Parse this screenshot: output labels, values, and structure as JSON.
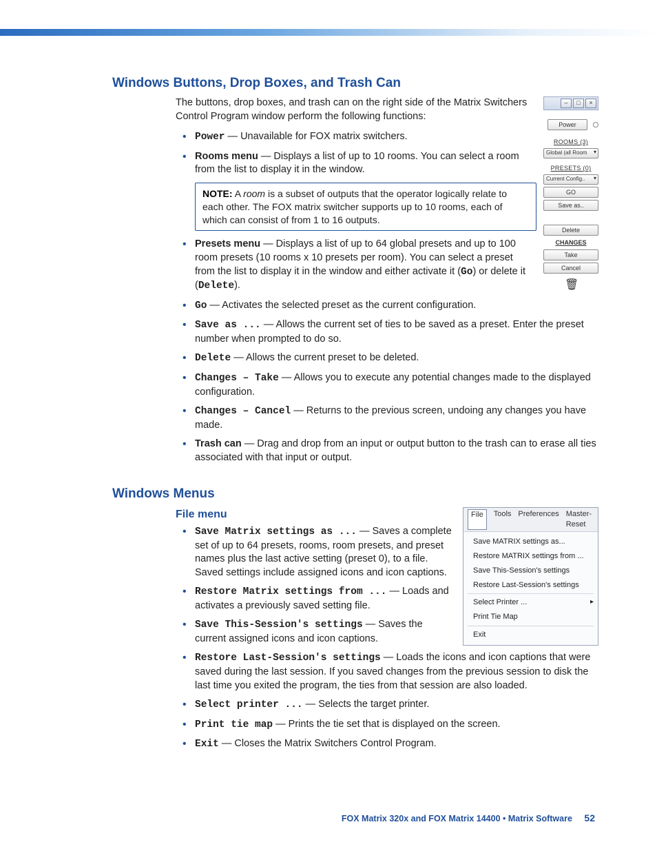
{
  "sections": {
    "s1_title": "Windows Buttons, Drop Boxes, and Trash Can",
    "s1_intro": "The buttons, drop boxes, and trash can on the right side of the Matrix Switchers Control Program window perform the following functions:",
    "s2_title": "Windows Menus",
    "s2_sub": "File menu"
  },
  "items1": {
    "power": {
      "term": "Power",
      "desc": " — Unavailable for FOX matrix switchers."
    },
    "rooms": {
      "term": "Rooms menu",
      "desc": " — Displays a list of up to 10 rooms. You can select a room from the list to display it in the window."
    },
    "note": {
      "label": "NOTE:",
      "body_pre": "A ",
      "body_em": "room",
      "body_post": " is a subset of outputs that the operator logically relate to each other. The FOX matrix switcher supports up to 10 rooms, each of which can consist of from 1 to 16 outputs."
    },
    "presets": {
      "term": "Presets menu",
      "desc_a": " — Displays a list of up to 64 global presets and up to 100 room presets (10 rooms x 10 presets per room). You can select a preset from the list to display it in the window and either activate it (",
      "go": "Go",
      "desc_b": ") or delete it (",
      "del": "Delete",
      "desc_c": ")."
    },
    "go": {
      "term": "Go",
      "desc": " — Activates the selected preset as the current configuration."
    },
    "saveas": {
      "term": "Save as ...",
      "desc": " — Allows the current set of ties to be saved as a preset. Enter the preset number when prompted to do so."
    },
    "delete": {
      "term": "Delete",
      "desc": " — Allows the current preset to be deleted."
    },
    "take": {
      "term": "Changes – Take",
      "desc": " — Allows you to execute any potential changes made to the displayed configuration."
    },
    "cancel": {
      "term": "Changes – Cancel",
      "desc": " — Returns to the previous screen, undoing any changes you have made."
    },
    "trash": {
      "term": "Trash can",
      "desc": " — Drag and drop from an input or output button to the trash can to erase all ties associated with that input or output."
    }
  },
  "items2": {
    "save_matrix": {
      "term": "Save Matrix settings as ...",
      "desc": " — Saves a complete set of up to 64 presets, rooms, room presets, and preset names plus the last active setting (preset 0), to a file. Saved settings include assigned icons and icon captions."
    },
    "restore_matrix": {
      "term": "Restore Matrix settings from ...",
      "desc": " — Loads and activates a previously saved setting file."
    },
    "save_session": {
      "term": "Save This-Session's settings",
      "desc": " — Saves the current assigned icons and icon captions."
    },
    "restore_session": {
      "term": "Restore Last-Session's settings",
      "desc": " — Loads the icons and icon captions that were saved during the last session. If you saved changes from the previous session to disk the last time you exited the program, the ties from that session are also loaded."
    },
    "printer": {
      "term": "Select printer ...",
      "desc": " — Selects the target printer."
    },
    "print": {
      "term": "Print tie map",
      "desc": " — Prints the tie set that is displayed on the screen."
    },
    "exit": {
      "term": "Exit",
      "desc": " — Closes the Matrix Switchers Control Program."
    }
  },
  "panel": {
    "power_btn": "Power",
    "rooms_label": "ROOMS (3)",
    "rooms_dd": "Global (all Room",
    "presets_label": "PRESETS (0)",
    "presets_dd": "Current Config..",
    "go_btn": "GO",
    "saveas_btn": "Save as..",
    "delete_btn": "Delete",
    "changes_label": "CHANGES",
    "take_btn": "Take",
    "cancel_btn": "Cancel"
  },
  "menu": {
    "bar": {
      "file": "File",
      "tools": "Tools",
      "prefs": "Preferences",
      "reset": "Master-Reset"
    },
    "items": {
      "m1": "Save MATRIX settings as...",
      "m2": "Restore MATRIX settings from ...",
      "m3": "Save This-Session's settings",
      "m4": "Restore Last-Session's settings",
      "m5": "Select Printer ...",
      "m6": "Print Tie Map",
      "m7": "Exit"
    }
  },
  "footer": {
    "text": "FOX Matrix 320x and FOX Matrix 14400 • Matrix Software",
    "page": "52"
  }
}
